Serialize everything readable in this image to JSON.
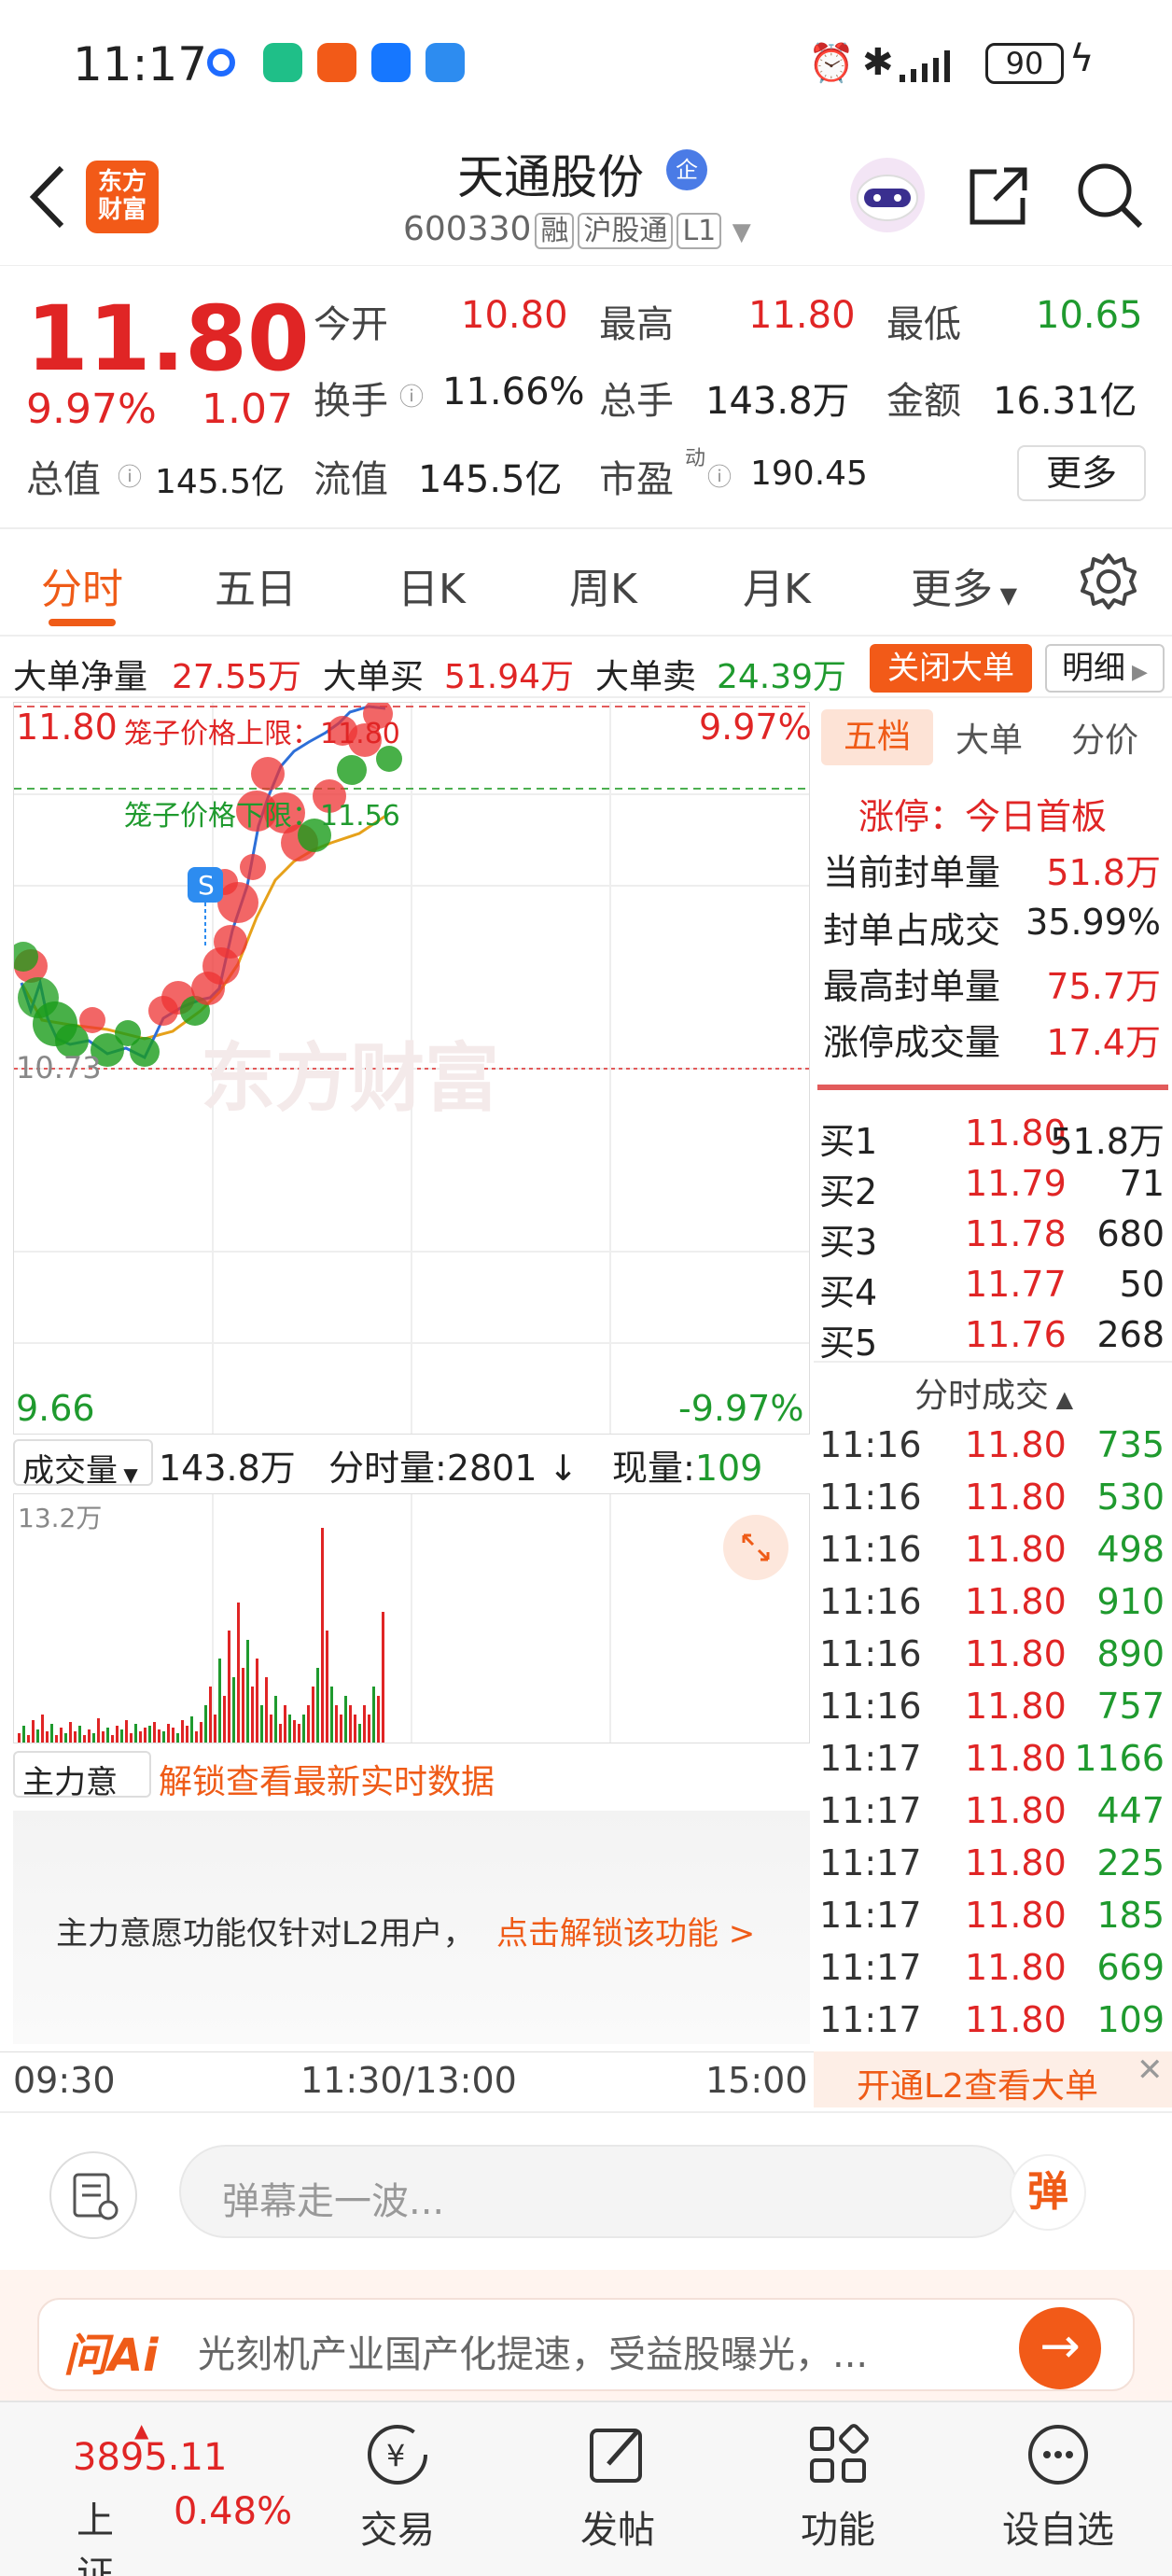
{
  "status_bar": {
    "time": "11:17",
    "battery": "90"
  },
  "header": {
    "logo_line1": "东方",
    "logo_line2": "财富",
    "stock_name": "天通股份",
    "badge": "企",
    "code": "600330",
    "tag_rong": "融",
    "tag_hgt": "沪股通",
    "tag_level": "L1"
  },
  "quote": {
    "price": "11.80",
    "change_pct": "9.97%",
    "change": "1.07",
    "open_label": "今开",
    "open": "10.80",
    "high_label": "最高",
    "high": "11.80",
    "low_label": "最低",
    "low": "10.65",
    "turnover_label": "换手",
    "turnover": "11.66%",
    "volume_label": "总手",
    "volume": "143.8万",
    "amount_label": "金额",
    "amount": "16.31亿",
    "mktcap_label": "总值",
    "mktcap": "145.5亿",
    "float_label": "流值",
    "float": "145.5亿",
    "pe_label": "市盈",
    "pe_sup": "动",
    "pe": "190.45",
    "more": "更多"
  },
  "tabs": [
    "分时",
    "五日",
    "日K",
    "周K",
    "月K",
    "更多"
  ],
  "big_order": {
    "net_label": "大单净量",
    "net": "27.55万",
    "buy_label": "大单买",
    "buy": "51.94万",
    "sell_label": "大单卖",
    "sell": "24.39万",
    "close_btn": "关闭大单",
    "detail_btn": "明细"
  },
  "chart": {
    "top_price": "11.80",
    "top_pct": "9.97%",
    "bottom_price": "9.66",
    "bottom_pct": "-9.97%",
    "upper_limit_label": "笼子价格上限：11.80",
    "lower_limit_label": "笼子价格下限：11.56",
    "prev_close": "10.73",
    "watermark": "东方财富",
    "s_marker": "S"
  },
  "volume_bar": {
    "selector": "成交量",
    "total": "143.8万",
    "period_label": "分时量:",
    "period": "2801",
    "now_label": "现量:",
    "now": "109",
    "max_label": "13.2万"
  },
  "zhuli": {
    "selector": "主力意愿",
    "unlock_text": "解锁查看最新实时数据",
    "lock_msg": "主力意愿功能仅针对L2用户，",
    "lock_link": "点击解锁该功能 >"
  },
  "time_axis": [
    "09:30",
    "11:30/13:00",
    "15:00"
  ],
  "right_panel": {
    "tabs": [
      "五档",
      "大单",
      "分价"
    ],
    "limit_title": "涨停：今日首板",
    "limit_rows": [
      {
        "label": "当前封单量",
        "value": "51.8万"
      },
      {
        "label": "封单占成交",
        "value": "35.99%"
      },
      {
        "label": "最高封单量",
        "value": "75.7万"
      },
      {
        "label": "涨停成交量",
        "value": "17.4万"
      }
    ],
    "bids": [
      {
        "label": "买1",
        "price": "11.80",
        "qty": "51.8万"
      },
      {
        "label": "买2",
        "price": "11.79",
        "qty": "71"
      },
      {
        "label": "买3",
        "price": "11.78",
        "qty": "680"
      },
      {
        "label": "买4",
        "price": "11.77",
        "qty": "50"
      },
      {
        "label": "买5",
        "price": "11.76",
        "qty": "268"
      }
    ],
    "trades_title": "分时成交",
    "trades": [
      {
        "t": "11:16",
        "p": "11.80",
        "n": "735"
      },
      {
        "t": "11:16",
        "p": "11.80",
        "n": "530"
      },
      {
        "t": "11:16",
        "p": "11.80",
        "n": "498"
      },
      {
        "t": "11:16",
        "p": "11.80",
        "n": "910"
      },
      {
        "t": "11:16",
        "p": "11.80",
        "n": "890"
      },
      {
        "t": "11:16",
        "p": "11.80",
        "n": "757"
      },
      {
        "t": "11:17",
        "p": "11.80",
        "n": "1166"
      },
      {
        "t": "11:17",
        "p": "11.80",
        "n": "447"
      },
      {
        "t": "11:17",
        "p": "11.80",
        "n": "225"
      },
      {
        "t": "11:17",
        "p": "11.80",
        "n": "185"
      },
      {
        "t": "11:17",
        "p": "11.80",
        "n": "669"
      },
      {
        "t": "11:17",
        "p": "11.80",
        "n": "109"
      }
    ],
    "l2_btn": "开通L2查看大单"
  },
  "comment": {
    "placeholder": "弹幕走一波...",
    "danmu": "弹"
  },
  "ai_banner": {
    "logo": "问Ai",
    "text": "光刻机产业国产化提速，受益股曝光，..."
  },
  "bottom_nav": {
    "index_value": "3895.11",
    "index_name": "上证",
    "index_pct": "0.48%",
    "items": [
      "交易",
      "发帖",
      "功能",
      "设自选"
    ]
  },
  "colors": {
    "up": "#e02525",
    "down": "#1f9a2e",
    "accent": "#ef5b17"
  }
}
